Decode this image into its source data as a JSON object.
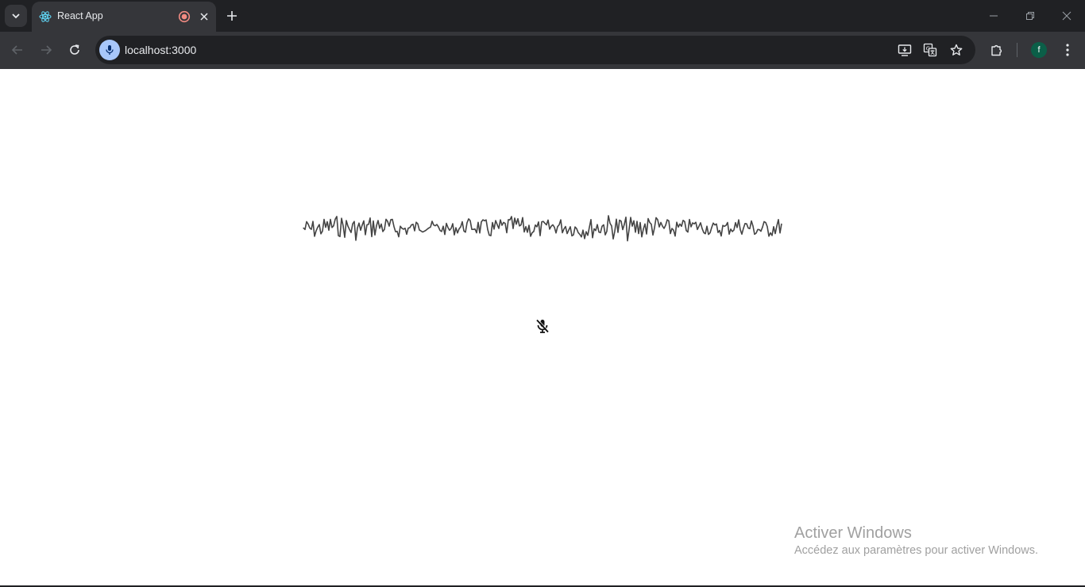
{
  "browser": {
    "tab": {
      "title": "React App",
      "favicon": "react-logo-icon",
      "audio_indicator": "recording-icon"
    },
    "address_bar": {
      "url": "localhost:3000"
    },
    "toolbar_icons": [
      "back-icon",
      "forward-icon",
      "reload-icon",
      "install-app-icon",
      "translate-icon",
      "bookmark-star-icon",
      "extensions-icon",
      "menu-icon"
    ],
    "profile": {
      "initial": "f",
      "color": "#0b5f48"
    }
  },
  "page": {
    "background": "#ffffff",
    "waveform": {
      "stroke_color": "#444444",
      "icon": "audio-waveform"
    },
    "mic_toggle": {
      "icon": "mic-off-icon",
      "state": "muted"
    }
  },
  "watermark": {
    "title": "Activer Windows",
    "subtitle": "Accédez aux paramètres pour activer Windows."
  }
}
